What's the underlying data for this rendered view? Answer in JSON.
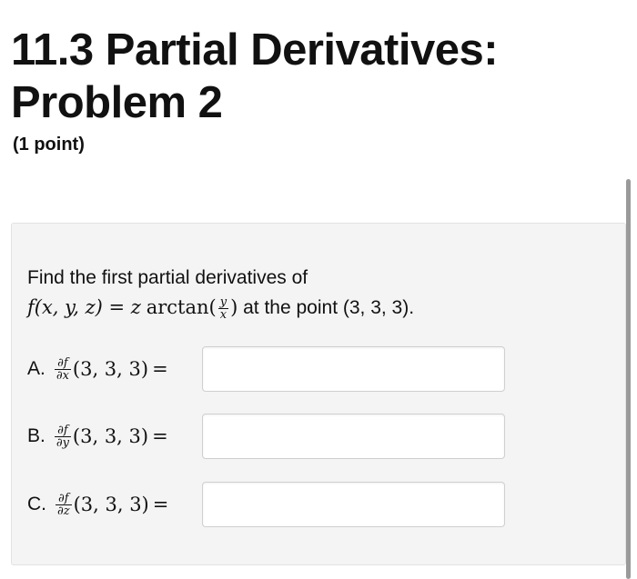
{
  "header": {
    "title_line1": "11.3 Partial Derivatives:",
    "title_line2": "Problem 2",
    "points": "(1 point)"
  },
  "problem": {
    "intro": "Find the first partial derivatives of",
    "function_lhs": "f(x, y, z) = z",
    "function_op": "arctan(",
    "frac_num": "y",
    "frac_den": "x",
    "function_close": ")",
    "at_text": "at the point (3, 3, 3).",
    "parts": [
      {
        "letter": "A.",
        "num": "∂f",
        "den": "∂x",
        "point": "(3, 3, 3)",
        "eq": "=",
        "value": ""
      },
      {
        "letter": "B.",
        "num": "∂f",
        "den": "∂y",
        "point": "(3, 3, 3)",
        "eq": "=",
        "value": ""
      },
      {
        "letter": "C.",
        "num": "∂f",
        "den": "∂z",
        "point": "(3, 3, 3)",
        "eq": "=",
        "value": ""
      }
    ]
  }
}
